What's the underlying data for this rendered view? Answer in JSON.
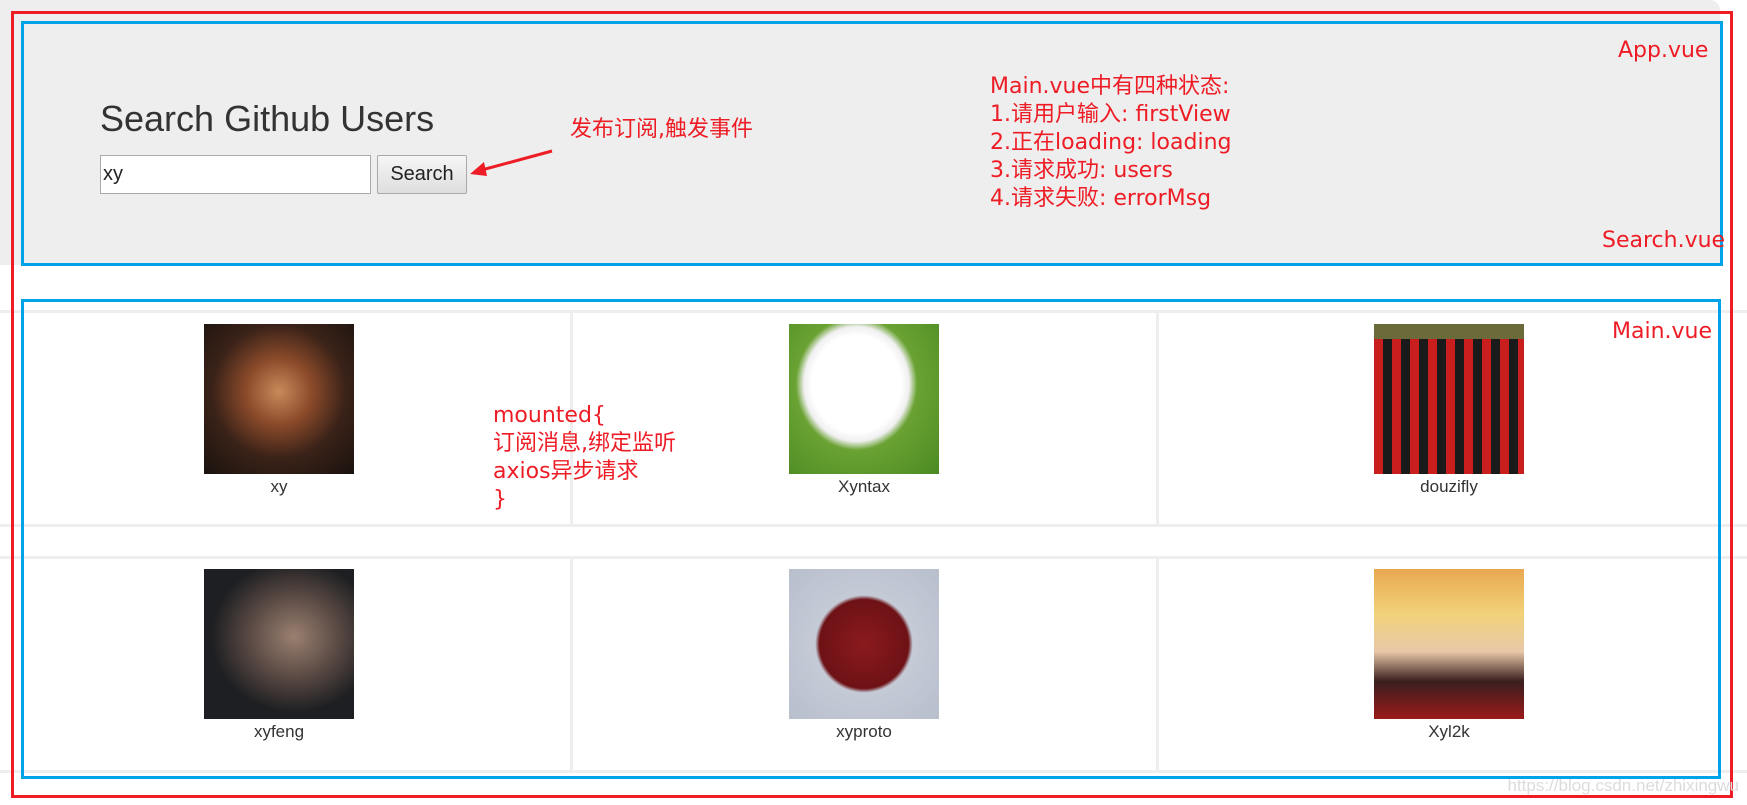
{
  "search": {
    "title": "Search Github Users",
    "input_value": "xy",
    "button_label": "Search"
  },
  "annotations": {
    "publish": "发布订阅,触发事件",
    "states": [
      "Main.vue中有四种状态:",
      "1.请用户输入: firstView",
      "2.正在loading: loading",
      "3.请求成功: users",
      "4.请求失败: errorMsg"
    ],
    "mounted": [
      "mounted{",
      "订阅消息,绑定监听",
      "axios异步请求",
      "}"
    ],
    "app_label": "App.vue",
    "search_label": "Search.vue",
    "main_label": "Main.vue"
  },
  "users": [
    {
      "login": "xy"
    },
    {
      "login": "Xyntax"
    },
    {
      "login": "douzifly"
    },
    {
      "login": "xyfeng"
    },
    {
      "login": "xyproto"
    },
    {
      "login": "Xyl2k"
    }
  ],
  "watermark": "https://blog.csdn.net/zhixingwu",
  "colors": {
    "annotation_red": "#ee1c25",
    "annotation_blue": "#00a2e8",
    "jumbotron": "#eeeeee"
  }
}
